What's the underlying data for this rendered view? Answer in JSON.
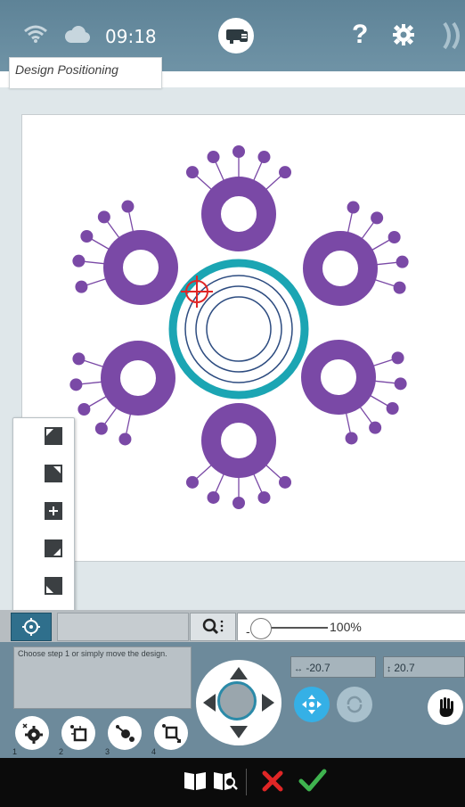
{
  "status_bar": {
    "time": "09:18",
    "help_label": "?",
    "icons": [
      "wifi-icon",
      "cloud-icon",
      "embroidery-machine-icon",
      "help-icon",
      "gear-icon",
      "edge-icon"
    ]
  },
  "tab": {
    "title": "Design Positioning"
  },
  "positioning_menu": {
    "items": [
      "top-left-corner",
      "top-right-corner",
      "center",
      "bottom-right-corner",
      "bottom-left-corner"
    ]
  },
  "toolbar": {
    "zoom_percent": "100%",
    "zoom_dash": "-"
  },
  "panel": {
    "hint": "Choose step 1 or simply move the design.",
    "x_value": "-20.7",
    "y_value": "20.7",
    "steps": [
      "1",
      "2",
      "3",
      "4"
    ]
  },
  "colors": {
    "accent": "#35b0e6",
    "design_purple": "#7a49a6",
    "ring_teal": "#1ba5b3",
    "cancel_red": "#e02626",
    "ok_green": "#3fb34f"
  },
  "bottom_bar": {
    "icons": [
      "book-icon",
      "book-search-icon",
      "cancel-icon",
      "confirm-icon"
    ]
  }
}
